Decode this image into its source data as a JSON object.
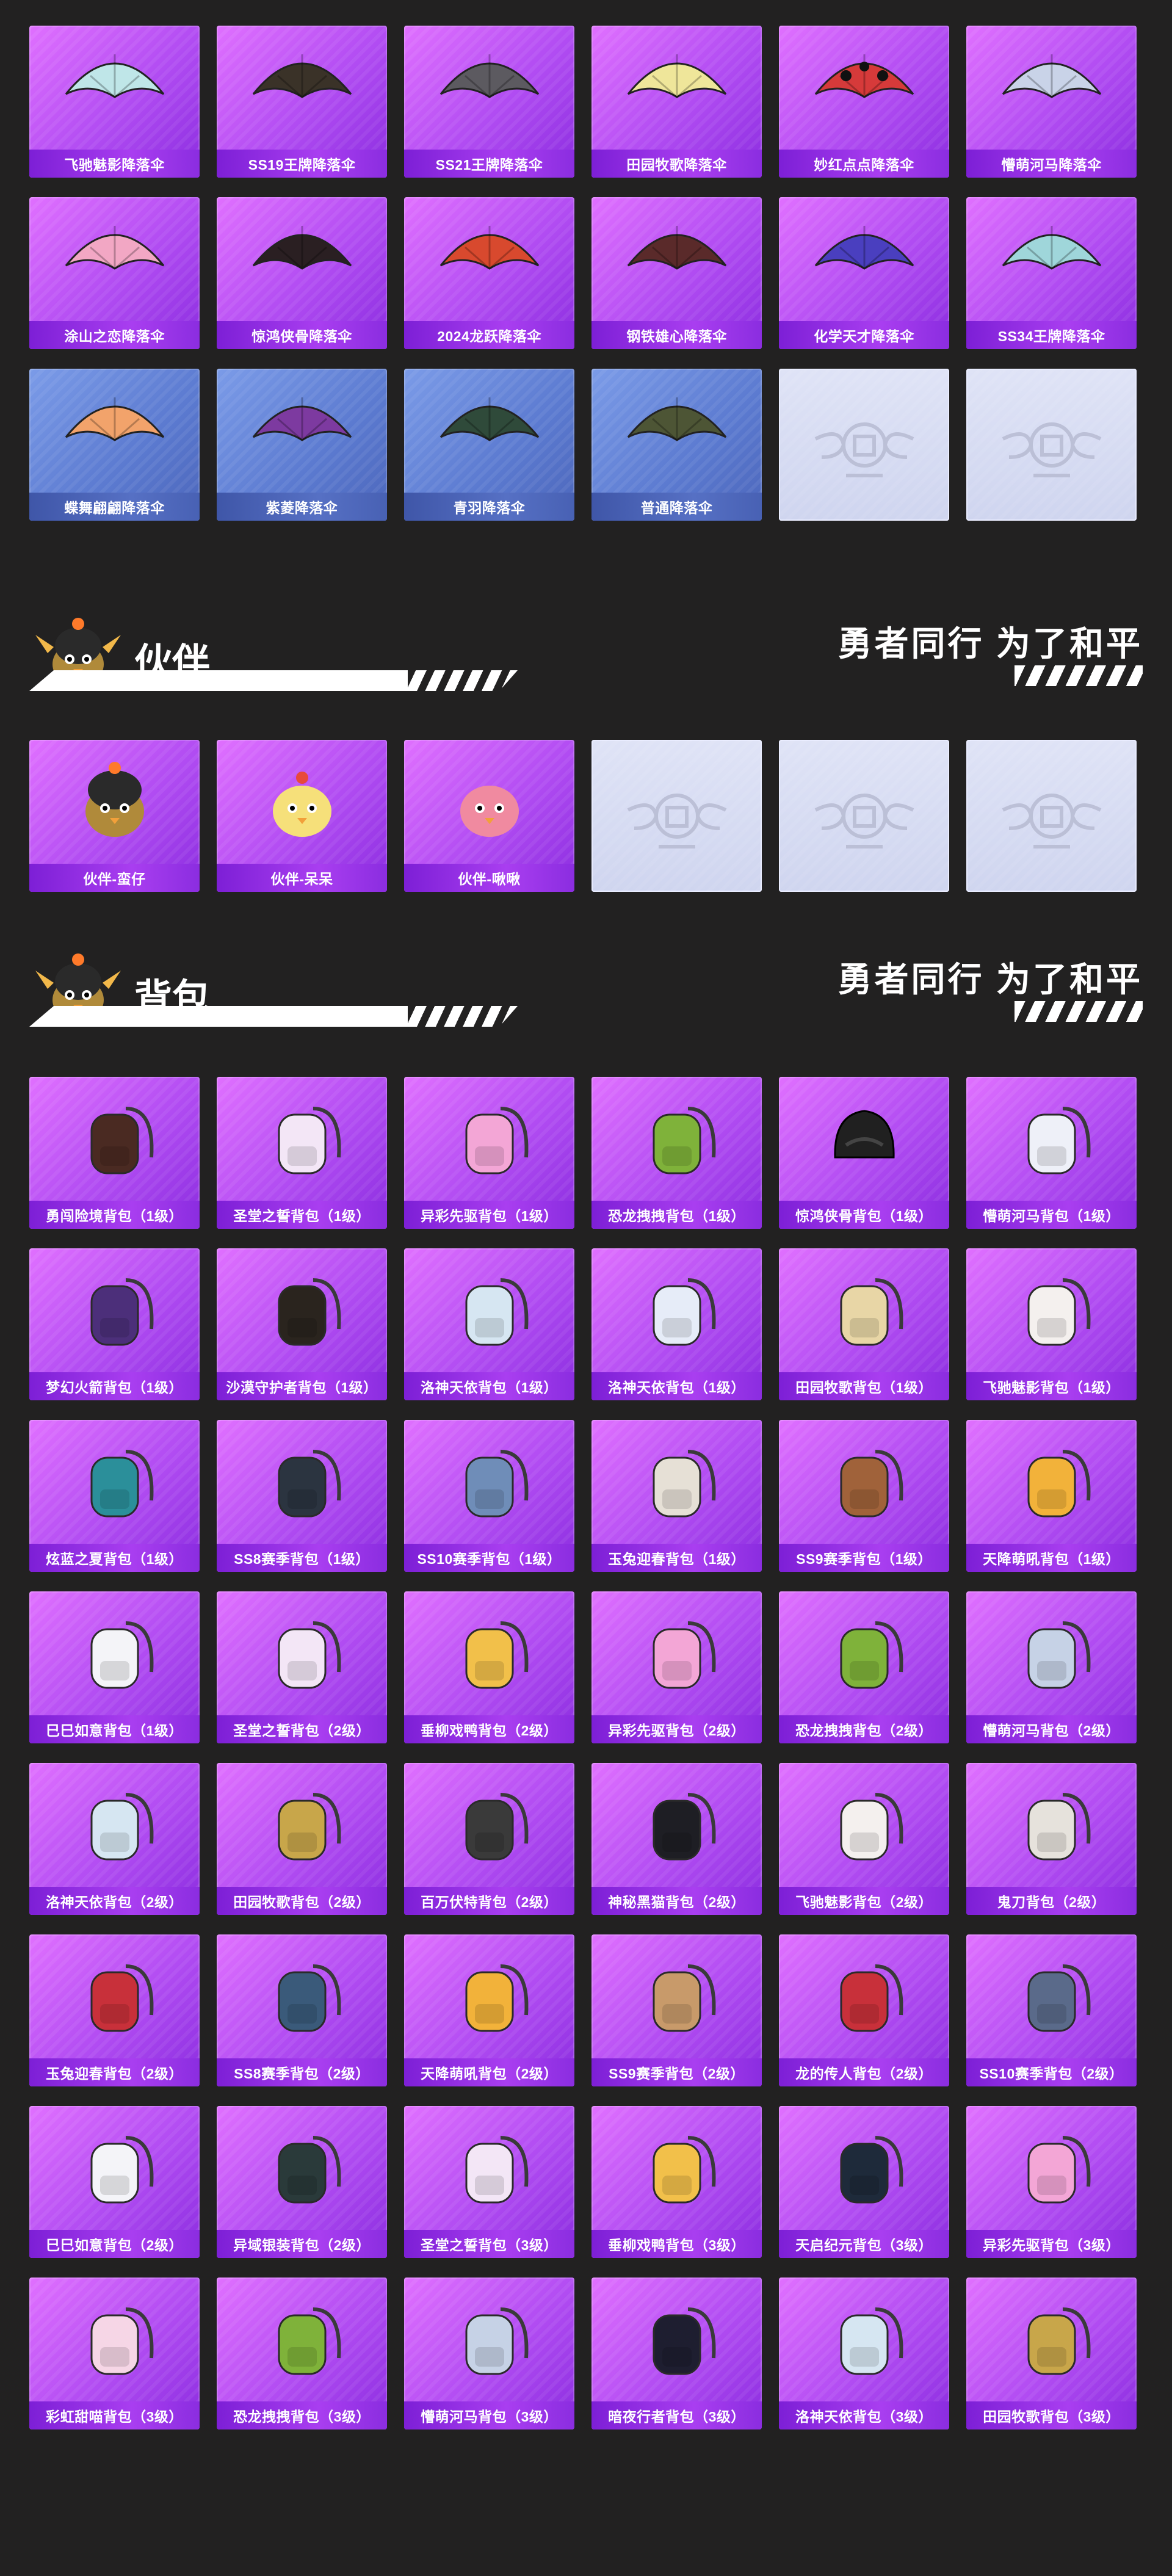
{
  "colors": {
    "background": "#222121",
    "card_purple": "#b14cf2",
    "card_blue": "#5b7ad0",
    "empty": "#dfe3f6"
  },
  "parachutes": [
    {
      "label": "飞驰魅影降落伞",
      "style": "purple",
      "icon": "parachute-icon",
      "color": "#bfe6e8"
    },
    {
      "label": "SS19王牌降落伞",
      "style": "purple",
      "icon": "parachute-icon",
      "color": "#3a3228"
    },
    {
      "label": "SS21王牌降落伞",
      "style": "purple",
      "icon": "parachute-icon",
      "color": "#5c5a60"
    },
    {
      "label": "田园牧歌降落伞",
      "style": "purple",
      "icon": "parachute-icon",
      "color": "#efe69a"
    },
    {
      "label": "妙红点点降落伞",
      "style": "purple",
      "icon": "ladybug-parachute-icon",
      "color": "#d63a3a"
    },
    {
      "label": "懵萌河马降落伞",
      "style": "purple",
      "icon": "parachute-icon",
      "color": "#c9d3e8"
    },
    {
      "label": "涂山之恋降落伞",
      "style": "purple",
      "icon": "parachute-icon",
      "color": "#f2a7c4"
    },
    {
      "label": "惊鸿侠骨降落伞",
      "style": "purple",
      "icon": "parachute-icon",
      "color": "#2a1f22"
    },
    {
      "label": "2024龙跃降落伞",
      "style": "purple",
      "icon": "parachute-icon",
      "color": "#d8492e"
    },
    {
      "label": "钢铁雄心降落伞",
      "style": "purple",
      "icon": "parachute-icon",
      "color": "#5a2a2a"
    },
    {
      "label": "化学天才降落伞",
      "style": "purple",
      "icon": "parachute-icon",
      "color": "#4a3fbf"
    },
    {
      "label": "SS34王牌降落伞",
      "style": "purple",
      "icon": "parachute-icon",
      "color": "#9fd6da"
    },
    {
      "label": "蝶舞翩翩降落伞",
      "style": "blue",
      "icon": "parachute-icon",
      "color": "#f2a36b"
    },
    {
      "label": "紫菱降落伞",
      "style": "blue",
      "icon": "parachute-icon",
      "color": "#7d3aa0"
    },
    {
      "label": "青羽降落伞",
      "style": "blue",
      "icon": "parachute-icon",
      "color": "#2f4a3a"
    },
    {
      "label": "普通降落伞",
      "style": "blue",
      "icon": "parachute-icon",
      "color": "#4d5535"
    },
    {
      "label": "",
      "style": "empty",
      "icon": "pubg-emblem-icon",
      "color": "#c7cbe0"
    },
    {
      "label": "",
      "style": "empty",
      "icon": "pubg-emblem-icon",
      "color": "#c7cbe0"
    }
  ],
  "companion_section": {
    "title": "伙伴",
    "slogan": "勇者同行 为了和平",
    "mascot_icon": "chick-helmet-mascot-icon"
  },
  "companions": [
    {
      "label": "伙伴-蛮仔",
      "style": "purple",
      "icon": "chick-helmet-icon",
      "color": "#2b2b2b"
    },
    {
      "label": "伙伴-呆呆",
      "style": "purple",
      "icon": "chick-icon",
      "color": "#f6e07a"
    },
    {
      "label": "伙伴-啾啾",
      "style": "purple",
      "icon": "pink-bird-icon",
      "color": "#f08aa0"
    },
    {
      "label": "",
      "style": "empty",
      "icon": "pubg-emblem-icon",
      "color": "#c7cbe0"
    },
    {
      "label": "",
      "style": "empty",
      "icon": "pubg-emblem-icon",
      "color": "#c7cbe0"
    },
    {
      "label": "",
      "style": "empty",
      "icon": "pubg-emblem-icon",
      "color": "#c7cbe0"
    }
  ],
  "backpack_section": {
    "title": "背包",
    "slogan": "勇者同行 为了和平",
    "mascot_icon": "chick-helmet-mascot-icon"
  },
  "backpacks": [
    {
      "label": "勇闯险境背包（1级）",
      "style": "purple",
      "icon": "backpack-icon",
      "color": "#4a2a22"
    },
    {
      "label": "圣堂之誓背包（1级）",
      "style": "purple",
      "icon": "backpack-icon",
      "color": "#f3e6f6"
    },
    {
      "label": "异彩先驱背包（1级）",
      "style": "purple",
      "icon": "backpack-icon",
      "color": "#f3a6d6"
    },
    {
      "label": "恐龙拽拽背包（1级）",
      "style": "purple",
      "icon": "backpack-icon",
      "color": "#7fb23a"
    },
    {
      "label": "惊鸿侠骨背包（1级）",
      "style": "purple",
      "icon": "helmet-backpack-icon",
      "color": "#202020"
    },
    {
      "label": "懵萌河马背包（1级）",
      "style": "purple",
      "icon": "backpack-icon",
      "color": "#eef0f8"
    },
    {
      "label": "梦幻火箭背包（1级）",
      "style": "purple",
      "icon": "backpack-icon",
      "color": "#4c2f7a"
    },
    {
      "label": "沙漠守护者背包（1级）",
      "style": "purple",
      "icon": "backpack-icon",
      "color": "#2a241e"
    },
    {
      "label": "洛神天依背包（1级）",
      "style": "purple",
      "icon": "backpack-icon",
      "color": "#d6e6f2"
    },
    {
      "label": "洛神天依背包（1级）",
      "style": "purple",
      "icon": "backpack-icon",
      "color": "#e6ecf8"
    },
    {
      "label": "田园牧歌背包（1级）",
      "style": "purple",
      "icon": "backpack-icon",
      "color": "#e8d6a6"
    },
    {
      "label": "飞驰魅影背包（1级）",
      "style": "purple",
      "icon": "backpack-icon",
      "color": "#f4f0ee"
    },
    {
      "label": "炫蓝之夏背包（1级）",
      "style": "purple",
      "icon": "backpack-icon",
      "color": "#2b8f9a"
    },
    {
      "label": "SS8赛季背包（1级）",
      "style": "purple",
      "icon": "backpack-icon",
      "color": "#2b3440"
    },
    {
      "label": "SS10赛季背包（1级）",
      "style": "purple",
      "icon": "backpack-icon",
      "color": "#6f8db8"
    },
    {
      "label": "玉兔迎春背包（1级）",
      "style": "purple",
      "icon": "backpack-icon",
      "color": "#e6e0d6"
    },
    {
      "label": "SS9赛季背包（1级）",
      "style": "purple",
      "icon": "backpack-icon",
      "color": "#a0623a"
    },
    {
      "label": "天降萌吼背包（1级）",
      "style": "purple",
      "icon": "backpack-icon",
      "color": "#f2b23a"
    },
    {
      "label": "巳巳如意背包（1级）",
      "style": "purple",
      "icon": "backpack-icon",
      "color": "#f4f4f8"
    },
    {
      "label": "圣堂之誓背包（2级）",
      "style": "purple",
      "icon": "backpack-icon",
      "color": "#f3e6f6"
    },
    {
      "label": "垂柳戏鸭背包（2级）",
      "style": "purple",
      "icon": "backpack-icon",
      "color": "#f2c04a"
    },
    {
      "label": "异彩先驱背包（2级）",
      "style": "purple",
      "icon": "backpack-icon",
      "color": "#f3a6d6"
    },
    {
      "label": "恐龙拽拽背包（2级）",
      "style": "purple",
      "icon": "backpack-icon",
      "color": "#7fb23a"
    },
    {
      "label": "懵萌河马背包（2级）",
      "style": "purple",
      "icon": "backpack-icon",
      "color": "#c6d2e6"
    },
    {
      "label": "洛神天依背包（2级）",
      "style": "purple",
      "icon": "backpack-icon",
      "color": "#d6e6f2"
    },
    {
      "label": "田园牧歌背包（2级）",
      "style": "purple",
      "icon": "backpack-icon",
      "color": "#c8a64a"
    },
    {
      "label": "百万伏特背包（2级）",
      "style": "purple",
      "icon": "backpack-icon",
      "color": "#3a3a3a"
    },
    {
      "label": "神秘黑猫背包（2级）",
      "style": "purple",
      "icon": "backpack-icon",
      "color": "#1e1e24"
    },
    {
      "label": "飞驰魅影背包（2级）",
      "style": "purple",
      "icon": "backpack-icon",
      "color": "#f4f0ee"
    },
    {
      "label": "鬼刀背包（2级）",
      "style": "purple",
      "icon": "backpack-icon",
      "color": "#e6e2dc"
    },
    {
      "label": "玉兔迎春背包（2级）",
      "style": "purple",
      "icon": "backpack-icon",
      "color": "#c8303a"
    },
    {
      "label": "SS8赛季背包（2级）",
      "style": "purple",
      "icon": "backpack-icon",
      "color": "#3a5a7a"
    },
    {
      "label": "天降萌吼背包（2级）",
      "style": "purple",
      "icon": "backpack-icon",
      "color": "#f2b23a"
    },
    {
      "label": "SS9赛季背包（2级）",
      "style": "purple",
      "icon": "backpack-icon",
      "color": "#c89a6a"
    },
    {
      "label": "龙的传人背包（2级）",
      "style": "purple",
      "icon": "backpack-icon",
      "color": "#c8303a"
    },
    {
      "label": "SS10赛季背包（2级）",
      "style": "purple",
      "icon": "backpack-icon",
      "color": "#5a6a8a"
    },
    {
      "label": "巳巳如意背包（2级）",
      "style": "purple",
      "icon": "backpack-icon",
      "color": "#f4f4f8"
    },
    {
      "label": "异域银装背包（2级）",
      "style": "purple",
      "icon": "backpack-icon",
      "color": "#2a3a3a"
    },
    {
      "label": "圣堂之誓背包（3级）",
      "style": "purple",
      "icon": "backpack-icon",
      "color": "#f3e6f6"
    },
    {
      "label": "垂柳戏鸭背包（3级）",
      "style": "purple",
      "icon": "backpack-icon",
      "color": "#f2c04a"
    },
    {
      "label": "天启纪元背包（3级）",
      "style": "purple",
      "icon": "backpack-icon",
      "color": "#1e2a3a"
    },
    {
      "label": "异彩先驱背包（3级）",
      "style": "purple",
      "icon": "backpack-icon",
      "color": "#f3a6d6"
    },
    {
      "label": "彩虹甜喵背包（3级）",
      "style": "purple",
      "icon": "backpack-icon",
      "color": "#f6d6e6"
    },
    {
      "label": "恐龙拽拽背包（3级）",
      "style": "purple",
      "icon": "backpack-icon",
      "color": "#7fb23a"
    },
    {
      "label": "懵萌河马背包（3级）",
      "style": "purple",
      "icon": "backpack-icon",
      "color": "#c6d2e6"
    },
    {
      "label": "暗夜行者背包（3级）",
      "style": "purple",
      "icon": "backpack-icon",
      "color": "#1e1e30"
    },
    {
      "label": "洛神天依背包（3级）",
      "style": "purple",
      "icon": "backpack-icon",
      "color": "#d6e6f2"
    },
    {
      "label": "田园牧歌背包（3级）",
      "style": "purple",
      "icon": "backpack-icon",
      "color": "#c8a64a"
    }
  ]
}
